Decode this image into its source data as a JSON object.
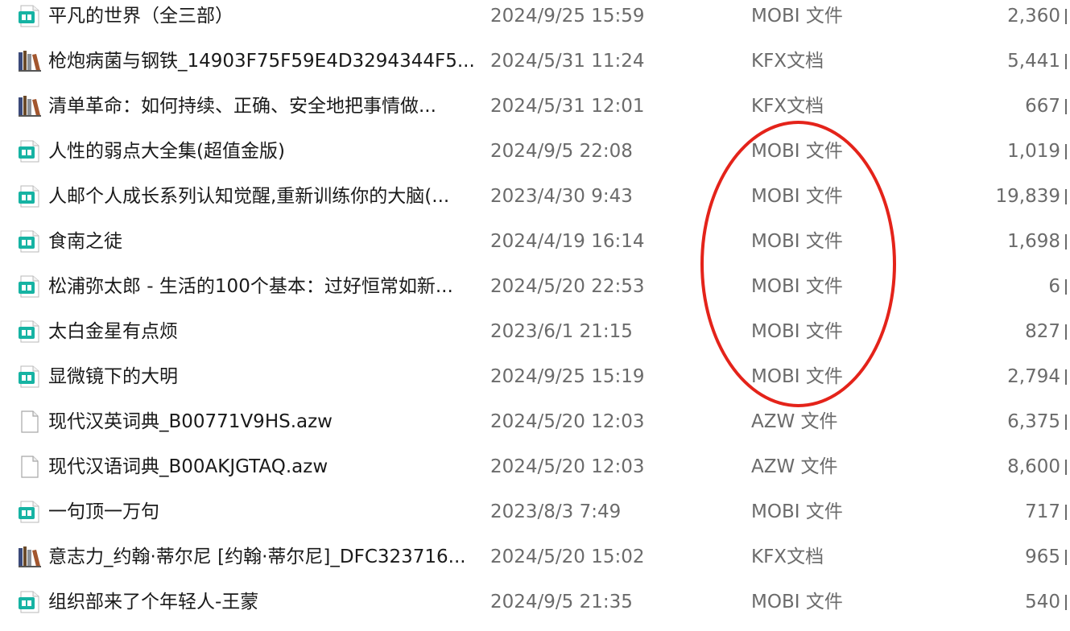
{
  "files": [
    {
      "name": "平凡的世界（全三部）",
      "date": "2024/9/25 15:59",
      "type": "MOBI 文件",
      "size": "2,360",
      "icon": "mobi-file-icon"
    },
    {
      "name": "枪炮病菌与钢铁_14903F75F59E4D3294344F5...",
      "date": "2024/5/31 11:24",
      "type": "KFX文档",
      "size": "5,441",
      "icon": "books-icon"
    },
    {
      "name": "清单革命：如何持续、正确、安全地把事情做...",
      "date": "2024/5/31 12:01",
      "type": "KFX文档",
      "size": "667",
      "icon": "books-icon"
    },
    {
      "name": "人性的弱点大全集(超值金版)",
      "date": "2024/9/5 22:08",
      "type": "MOBI 文件",
      "size": "1,019",
      "icon": "mobi-file-icon"
    },
    {
      "name": "人邮个人成长系列认知觉醒,重新训练你的大脑(...",
      "date": "2023/4/30 9:43",
      "type": "MOBI 文件",
      "size": "19,839",
      "icon": "mobi-file-icon"
    },
    {
      "name": "食南之徒",
      "date": "2024/4/19 16:14",
      "type": "MOBI 文件",
      "size": "1,698",
      "icon": "mobi-file-icon"
    },
    {
      "name": "松浦弥太郎 - 生活的100个基本：过好恒常如新...",
      "date": "2024/5/20 22:53",
      "type": "MOBI 文件",
      "size": "6",
      "icon": "mobi-file-icon"
    },
    {
      "name": "太白金星有点烦",
      "date": "2023/6/1 21:15",
      "type": "MOBI 文件",
      "size": "827",
      "icon": "mobi-file-icon"
    },
    {
      "name": "显微镜下的大明",
      "date": "2024/9/25 15:19",
      "type": "MOBI 文件",
      "size": "2,794",
      "icon": "mobi-file-icon"
    },
    {
      "name": "现代汉英词典_B00771V9HS.azw",
      "date": "2024/5/20 12:03",
      "type": "AZW 文件",
      "size": "6,375",
      "icon": "blank-file-icon"
    },
    {
      "name": "现代汉语词典_B00AKJGTAQ.azw",
      "date": "2024/5/20 12:03",
      "type": "AZW 文件",
      "size": "8,600",
      "icon": "blank-file-icon"
    },
    {
      "name": "一句顶一万句",
      "date": "2023/8/3 7:49",
      "type": "MOBI 文件",
      "size": "717",
      "icon": "mobi-file-icon"
    },
    {
      "name": "意志力_约翰·蒂尔尼 [约翰·蒂尔尼]_DFC323716...",
      "date": "2024/5/20 15:02",
      "type": "KFX文档",
      "size": "965",
      "icon": "books-icon"
    },
    {
      "name": "组织部来了个年轻人-王蒙",
      "date": "2024/9/5 21:35",
      "type": "MOBI 文件",
      "size": "540",
      "icon": "mobi-file-icon"
    }
  ],
  "colors": {
    "mobi_icon": "#16b3a3",
    "annotation": "#e4231a",
    "secondary_text": "#6b6b6b"
  }
}
